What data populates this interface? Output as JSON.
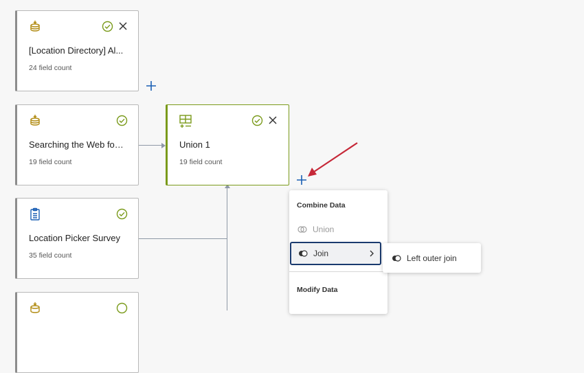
{
  "nodes": [
    {
      "title": "[Location Directory] Al...",
      "count": "24 field count",
      "icon": "database-icon"
    },
    {
      "title": "Searching the Web for...",
      "count": "19 field count",
      "icon": "database-icon"
    },
    {
      "title": "Union 1",
      "count": "19 field count",
      "icon": "table-add-icon"
    },
    {
      "title": "Location Picker Survey",
      "count": "35 field count",
      "icon": "clipboard-icon"
    }
  ],
  "menu": {
    "combine_heading": "Combine Data",
    "union_label": "Union",
    "join_label": "Join",
    "modify_heading": "Modify Data"
  },
  "submenu": {
    "left_outer_join_label": "Left outer join"
  },
  "colors": {
    "accent_blue": "#1a5fb4",
    "selected_green": "#7a9a1a",
    "arrow_red": "#c62838",
    "database_icon": "#b08a10"
  }
}
